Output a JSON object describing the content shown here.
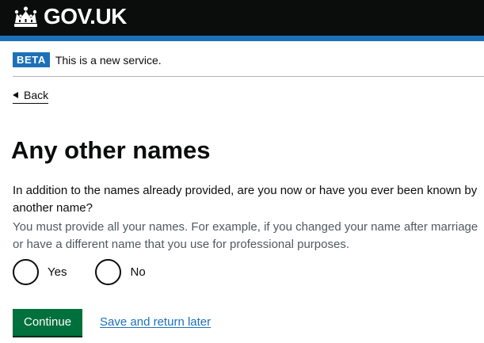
{
  "header": {
    "logo_text": "GOV.UK"
  },
  "phase_banner": {
    "tag": "BETA",
    "text": "This is a new service."
  },
  "back_link": {
    "label": "Back"
  },
  "page": {
    "title": "Any other names",
    "question": "In addition to the names already provided, are you now or have you ever been known by another name?",
    "hint": "You must provide all your names. For example, if you changed your name after marriage or have a different name that you use for professional purposes."
  },
  "radios": {
    "options": [
      {
        "label": "Yes",
        "selected": false
      },
      {
        "label": "No",
        "selected": false
      }
    ]
  },
  "actions": {
    "continue_label": "Continue",
    "save_label": "Save and return later"
  },
  "colors": {
    "header_background": "#0b0c0c",
    "brand_blue": "#1d70b8",
    "button_green": "#00703c",
    "hint_grey": "#505a5f"
  },
  "icons": {
    "logo": "crown-icon",
    "back": "triangle-left-icon"
  }
}
